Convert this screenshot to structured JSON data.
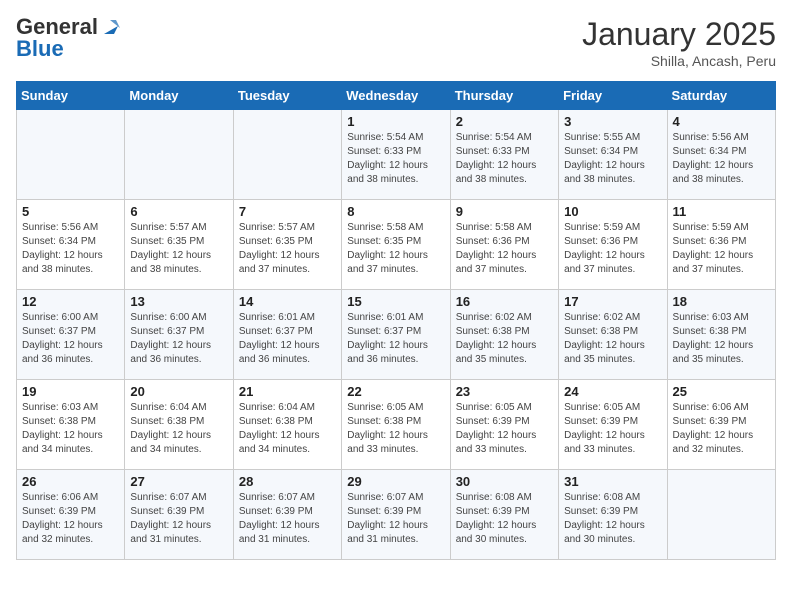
{
  "header": {
    "logo_general": "General",
    "logo_blue": "Blue",
    "cal_title": "January 2025",
    "cal_subtitle": "Shilla, Ancash, Peru"
  },
  "weekdays": [
    "Sunday",
    "Monday",
    "Tuesday",
    "Wednesday",
    "Thursday",
    "Friday",
    "Saturday"
  ],
  "weeks": [
    [
      {
        "day": "",
        "info": ""
      },
      {
        "day": "",
        "info": ""
      },
      {
        "day": "",
        "info": ""
      },
      {
        "day": "1",
        "info": "Sunrise: 5:54 AM\nSunset: 6:33 PM\nDaylight: 12 hours\nand 38 minutes."
      },
      {
        "day": "2",
        "info": "Sunrise: 5:54 AM\nSunset: 6:33 PM\nDaylight: 12 hours\nand 38 minutes."
      },
      {
        "day": "3",
        "info": "Sunrise: 5:55 AM\nSunset: 6:34 PM\nDaylight: 12 hours\nand 38 minutes."
      },
      {
        "day": "4",
        "info": "Sunrise: 5:56 AM\nSunset: 6:34 PM\nDaylight: 12 hours\nand 38 minutes."
      }
    ],
    [
      {
        "day": "5",
        "info": "Sunrise: 5:56 AM\nSunset: 6:34 PM\nDaylight: 12 hours\nand 38 minutes."
      },
      {
        "day": "6",
        "info": "Sunrise: 5:57 AM\nSunset: 6:35 PM\nDaylight: 12 hours\nand 38 minutes."
      },
      {
        "day": "7",
        "info": "Sunrise: 5:57 AM\nSunset: 6:35 PM\nDaylight: 12 hours\nand 37 minutes."
      },
      {
        "day": "8",
        "info": "Sunrise: 5:58 AM\nSunset: 6:35 PM\nDaylight: 12 hours\nand 37 minutes."
      },
      {
        "day": "9",
        "info": "Sunrise: 5:58 AM\nSunset: 6:36 PM\nDaylight: 12 hours\nand 37 minutes."
      },
      {
        "day": "10",
        "info": "Sunrise: 5:59 AM\nSunset: 6:36 PM\nDaylight: 12 hours\nand 37 minutes."
      },
      {
        "day": "11",
        "info": "Sunrise: 5:59 AM\nSunset: 6:36 PM\nDaylight: 12 hours\nand 37 minutes."
      }
    ],
    [
      {
        "day": "12",
        "info": "Sunrise: 6:00 AM\nSunset: 6:37 PM\nDaylight: 12 hours\nand 36 minutes."
      },
      {
        "day": "13",
        "info": "Sunrise: 6:00 AM\nSunset: 6:37 PM\nDaylight: 12 hours\nand 36 minutes."
      },
      {
        "day": "14",
        "info": "Sunrise: 6:01 AM\nSunset: 6:37 PM\nDaylight: 12 hours\nand 36 minutes."
      },
      {
        "day": "15",
        "info": "Sunrise: 6:01 AM\nSunset: 6:37 PM\nDaylight: 12 hours\nand 36 minutes."
      },
      {
        "day": "16",
        "info": "Sunrise: 6:02 AM\nSunset: 6:38 PM\nDaylight: 12 hours\nand 35 minutes."
      },
      {
        "day": "17",
        "info": "Sunrise: 6:02 AM\nSunset: 6:38 PM\nDaylight: 12 hours\nand 35 minutes."
      },
      {
        "day": "18",
        "info": "Sunrise: 6:03 AM\nSunset: 6:38 PM\nDaylight: 12 hours\nand 35 minutes."
      }
    ],
    [
      {
        "day": "19",
        "info": "Sunrise: 6:03 AM\nSunset: 6:38 PM\nDaylight: 12 hours\nand 34 minutes."
      },
      {
        "day": "20",
        "info": "Sunrise: 6:04 AM\nSunset: 6:38 PM\nDaylight: 12 hours\nand 34 minutes."
      },
      {
        "day": "21",
        "info": "Sunrise: 6:04 AM\nSunset: 6:38 PM\nDaylight: 12 hours\nand 34 minutes."
      },
      {
        "day": "22",
        "info": "Sunrise: 6:05 AM\nSunset: 6:38 PM\nDaylight: 12 hours\nand 33 minutes."
      },
      {
        "day": "23",
        "info": "Sunrise: 6:05 AM\nSunset: 6:39 PM\nDaylight: 12 hours\nand 33 minutes."
      },
      {
        "day": "24",
        "info": "Sunrise: 6:05 AM\nSunset: 6:39 PM\nDaylight: 12 hours\nand 33 minutes."
      },
      {
        "day": "25",
        "info": "Sunrise: 6:06 AM\nSunset: 6:39 PM\nDaylight: 12 hours\nand 32 minutes."
      }
    ],
    [
      {
        "day": "26",
        "info": "Sunrise: 6:06 AM\nSunset: 6:39 PM\nDaylight: 12 hours\nand 32 minutes."
      },
      {
        "day": "27",
        "info": "Sunrise: 6:07 AM\nSunset: 6:39 PM\nDaylight: 12 hours\nand 31 minutes."
      },
      {
        "day": "28",
        "info": "Sunrise: 6:07 AM\nSunset: 6:39 PM\nDaylight: 12 hours\nand 31 minutes."
      },
      {
        "day": "29",
        "info": "Sunrise: 6:07 AM\nSunset: 6:39 PM\nDaylight: 12 hours\nand 31 minutes."
      },
      {
        "day": "30",
        "info": "Sunrise: 6:08 AM\nSunset: 6:39 PM\nDaylight: 12 hours\nand 30 minutes."
      },
      {
        "day": "31",
        "info": "Sunrise: 6:08 AM\nSunset: 6:39 PM\nDaylight: 12 hours\nand 30 minutes."
      },
      {
        "day": "",
        "info": ""
      }
    ]
  ]
}
